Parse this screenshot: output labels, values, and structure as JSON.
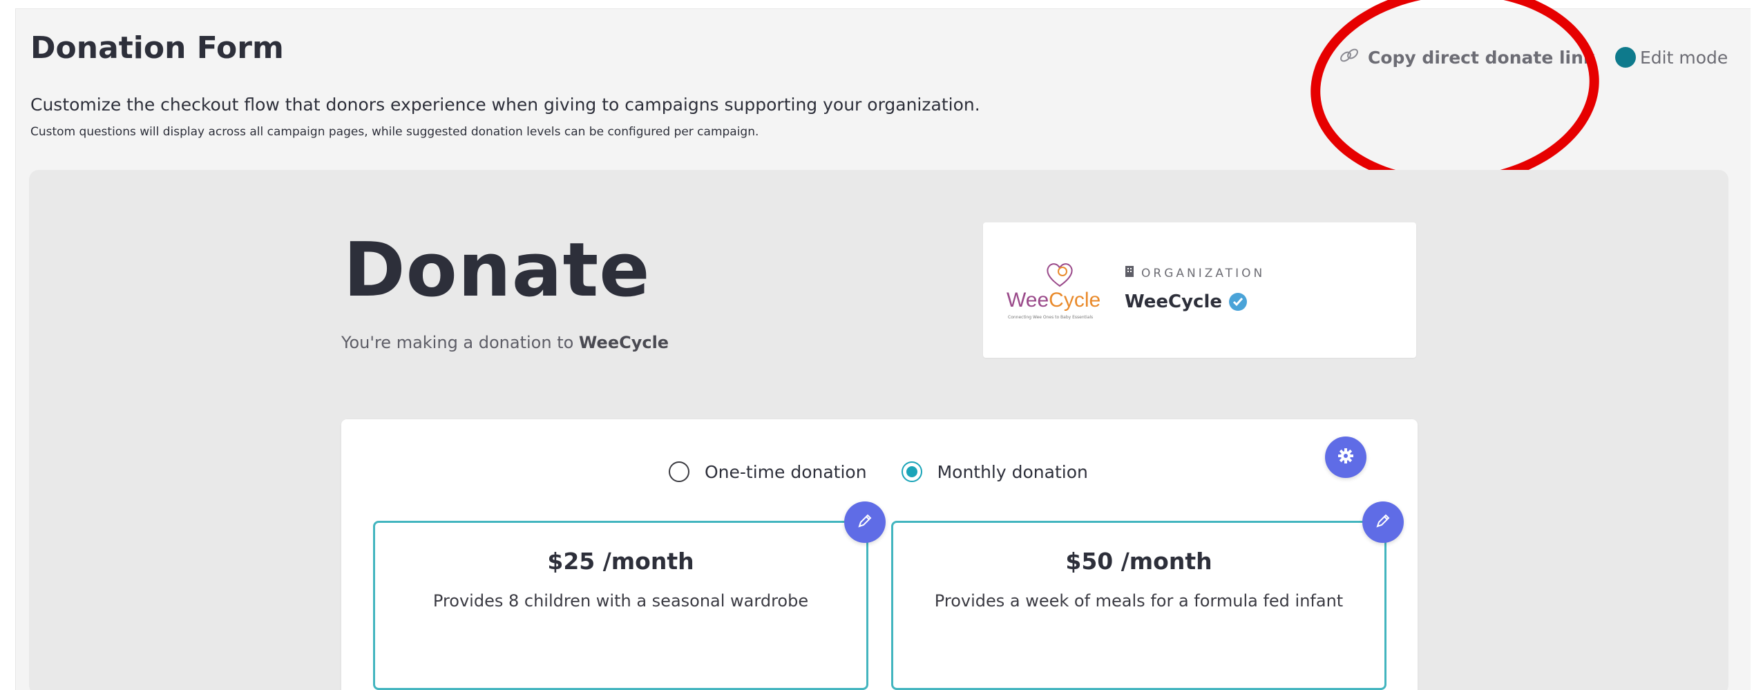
{
  "header": {
    "title": "Donation Form",
    "subtitle": "Customize the checkout flow that donors experience when giving to campaigns supporting your organization.",
    "note": "Custom questions will display across all campaign pages, while suggested donation levels can be configured per campaign.",
    "copy_link_label": "Copy direct donate link",
    "copy_link_icon": "link-icon",
    "edit_mode_label": "Edit mode",
    "edit_mode_on": true
  },
  "preview": {
    "heading": "Donate",
    "sub_prefix": "You're making a donation to ",
    "sub_org": "WeeCycle",
    "organization": {
      "label": "ORGANIZATION",
      "name": "WeeCycle",
      "logo_text_a": "Wee",
      "logo_text_b": "Cycle",
      "logo_tagline": "Connecting Wee Ones to Baby Essentials",
      "verified": true
    },
    "frequency": {
      "options": [
        "One-time donation",
        "Monthly donation"
      ],
      "selected": "Monthly donation"
    },
    "levels": [
      {
        "amount": "$25 /month",
        "description": "Provides 8 children with a seasonal wardrobe"
      },
      {
        "amount": "$50 /month",
        "description": "Provides a week of meals for a formula fed infant"
      }
    ]
  },
  "colors": {
    "accent": "#5f6ce6",
    "teal": "#1aa4b8",
    "card_border": "#43b5bf",
    "annotation": "#e60000"
  }
}
